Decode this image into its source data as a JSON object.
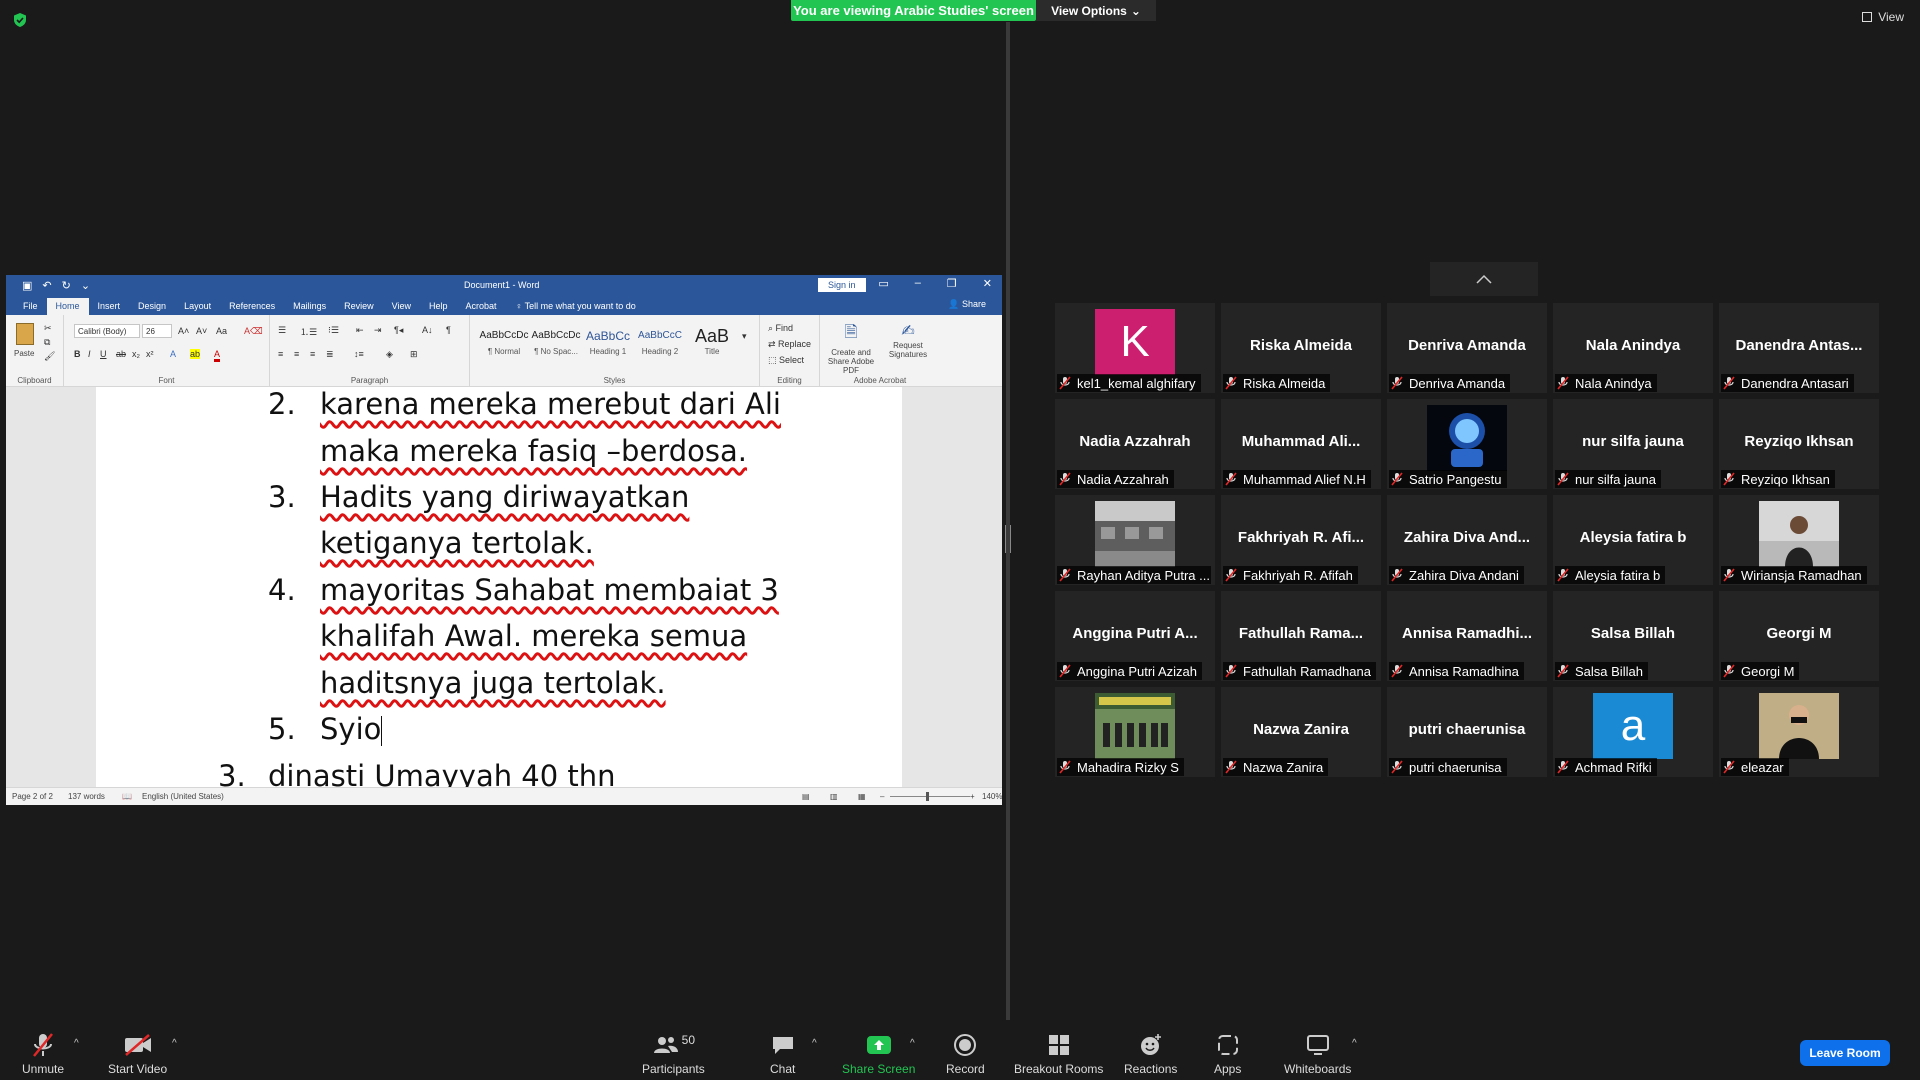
{
  "banner": {
    "text": "You are viewing Arabic Studies' screen",
    "view_options": "View Options"
  },
  "view": {
    "label": "View"
  },
  "word": {
    "title": "Document1  -  Word",
    "sign_in": "Sign in",
    "tabs": [
      "File",
      "Home",
      "Insert",
      "Design",
      "Layout",
      "References",
      "Mailings",
      "Review",
      "View",
      "Help",
      "Acrobat"
    ],
    "tell_me": "Tell me what you want to do",
    "share": "Share",
    "font_name": "Calibri (Body)",
    "font_size": "26",
    "paste": "Paste",
    "groups": [
      "Clipboard",
      "Font",
      "Paragraph",
      "Styles",
      "Editing",
      "Adobe Acrobat"
    ],
    "styles": [
      {
        "preview": "AaBbCcDc",
        "name": "¶ Normal"
      },
      {
        "preview": "AaBbCcDc",
        "name": "¶ No Spac..."
      },
      {
        "preview": "AaBbCc",
        "name": "Heading 1"
      },
      {
        "preview": "AaBbCcC",
        "name": "Heading 2"
      },
      {
        "preview": "AaB",
        "name": "Title"
      }
    ],
    "editing": [
      "Find",
      "Replace",
      "Select"
    ],
    "acrobat": [
      "Create and Share Adobe PDF",
      "Request Signatures"
    ],
    "doc_lines": {
      "n2": "2.",
      "l1": "karena mereka merebut dari Ali",
      "l2": "maka mereka fasiq –berdosa.",
      "n3": "3.",
      "l3": "Hadits yang diriwayatkan",
      "l4": "ketiganya tertolak.",
      "n4": "4.",
      "l5": "mayoritas Sahabat membaiat 3",
      "l6": "khalifah Awal. mereka semua",
      "l7": "haditsnya juga tertolak.",
      "n5": "5.",
      "l8": "Syio",
      "n3b": "3.",
      "l9": "dinasti Umayyah 40 thn"
    },
    "status": {
      "page": "Page 2 of 2",
      "words": "137 words",
      "language": "English (United States)",
      "zoom": "140%"
    }
  },
  "participants": [
    {
      "big": "",
      "name": "kel1_kemal alghifary",
      "avatar": "K",
      "avatar_color": "#cc1f6f"
    },
    {
      "big": "Riska Almeida",
      "name": "Riska Almeida"
    },
    {
      "big": "Denriva Amanda",
      "name": "Denriva Amanda"
    },
    {
      "big": "Nala Anindya",
      "name": "Nala Anindya"
    },
    {
      "big": "Danendra  Antas...",
      "name": "Danendra Antasari"
    },
    {
      "big": "Nadia Azzahrah",
      "name": "Nadia Azzahrah"
    },
    {
      "big": "Muhammad  Ali...",
      "name": "Muhammad Alief N.H"
    },
    {
      "big": "",
      "name": "Satrio Pangestu",
      "photo": "astronaut"
    },
    {
      "big": "nur silfa jauna",
      "name": "nur silfa jauna"
    },
    {
      "big": "Reyziqo Ikhsan",
      "name": "Reyziqo Ikhsan"
    },
    {
      "big": "",
      "name": "Rayhan Aditya Putra ...",
      "photo": "building"
    },
    {
      "big": "Fakhriyah  R. Afi...",
      "name": "Fakhriyah R. Afifah"
    },
    {
      "big": "Zahira  Diva  And...",
      "name": "Zahira Diva Andani"
    },
    {
      "big": "Aleysia fatira b",
      "name": "Aleysia fatira b"
    },
    {
      "big": "",
      "name": "Wiriansja Ramadhan",
      "photo": "person"
    },
    {
      "big": "Anggina  Putri  A...",
      "name": "Anggina Putri Azizah"
    },
    {
      "big": "Fathullah  Rama...",
      "name": "Fathullah Ramadhana"
    },
    {
      "big": "Annisa  Ramadhi...",
      "name": "Annisa Ramadhina"
    },
    {
      "big": "Salsa Billah",
      "name": "Salsa Billah"
    },
    {
      "big": "Georgi M",
      "name": "Georgi M"
    },
    {
      "big": "",
      "name": "Mahadira Rizky S",
      "photo": "group"
    },
    {
      "big": "Nazwa Zanira",
      "name": "Nazwa Zanira"
    },
    {
      "big": "putri chaerunisa",
      "name": "putri chaerunisa"
    },
    {
      "big": "",
      "name": "Achmad Rifki",
      "avatar": "a",
      "avatar_color": "#1a8ad4"
    },
    {
      "big": "",
      "name": "eleazar",
      "photo": "person2"
    }
  ],
  "toolbar": {
    "unmute": "Unmute",
    "start_video": "Start Video",
    "participants": "Participants",
    "participants_count": "50",
    "chat": "Chat",
    "share_screen": "Share Screen",
    "record": "Record",
    "breakout_rooms": "Breakout Rooms",
    "reactions": "Reactions",
    "apps": "Apps",
    "whiteboards": "Whiteboards",
    "leave": "Leave Room"
  },
  "colors": {
    "share_green": "#23c552",
    "word_blue": "#2b579a",
    "leave_blue": "#0e71eb",
    "mute_red": "#e02828"
  }
}
